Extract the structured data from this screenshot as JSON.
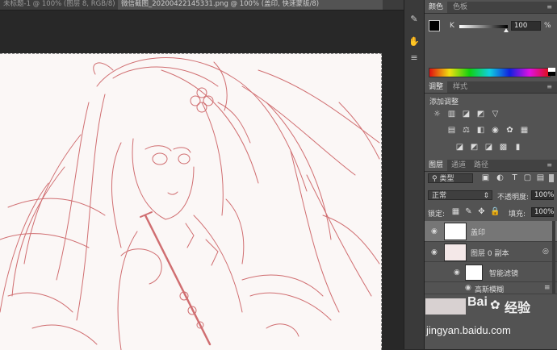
{
  "tabs": [
    {
      "label": "未标题-1 @ 100% (图层 8, RGB/8)",
      "active": false
    },
    {
      "label": "微信截图_20200422145331.png @ 100% (盖印, 快速蒙版/8)",
      "active": true
    }
  ],
  "tab_close": "×",
  "strip_icons": [
    "paint-brush-icon",
    "hand-tool-icon",
    "align-tool-icon"
  ],
  "color_panel": {
    "tabs": [
      "颜色",
      "色板"
    ],
    "channel_label": "K",
    "value": "100",
    "unit": "%"
  },
  "adjust_panel": {
    "tabs": [
      "调整",
      "样式"
    ],
    "title": "添加调整"
  },
  "layers_panel": {
    "tabs": [
      "图层",
      "通道",
      "路径"
    ],
    "filter_label": "类型",
    "blend_mode": "正常",
    "opacity_label": "不透明度:",
    "opacity_value": "100%",
    "lock_label": "锁定:",
    "fill_label": "填充:",
    "fill_value": "100%",
    "layers": [
      {
        "name": "盖印",
        "selected": true
      },
      {
        "name": "图层 0 副本",
        "selected": false
      },
      {
        "name": "智能滤镜",
        "selected": false
      },
      {
        "name": "高斯模糊",
        "selected": false
      }
    ]
  },
  "watermark": {
    "brand": "Bai",
    "logo_text": "经验",
    "url": "jingyan.baidu.com"
  },
  "colors": {
    "sketch_line": "#c9575a",
    "panel_bg": "#535353",
    "canvas_bg": "#fbf7f6"
  }
}
